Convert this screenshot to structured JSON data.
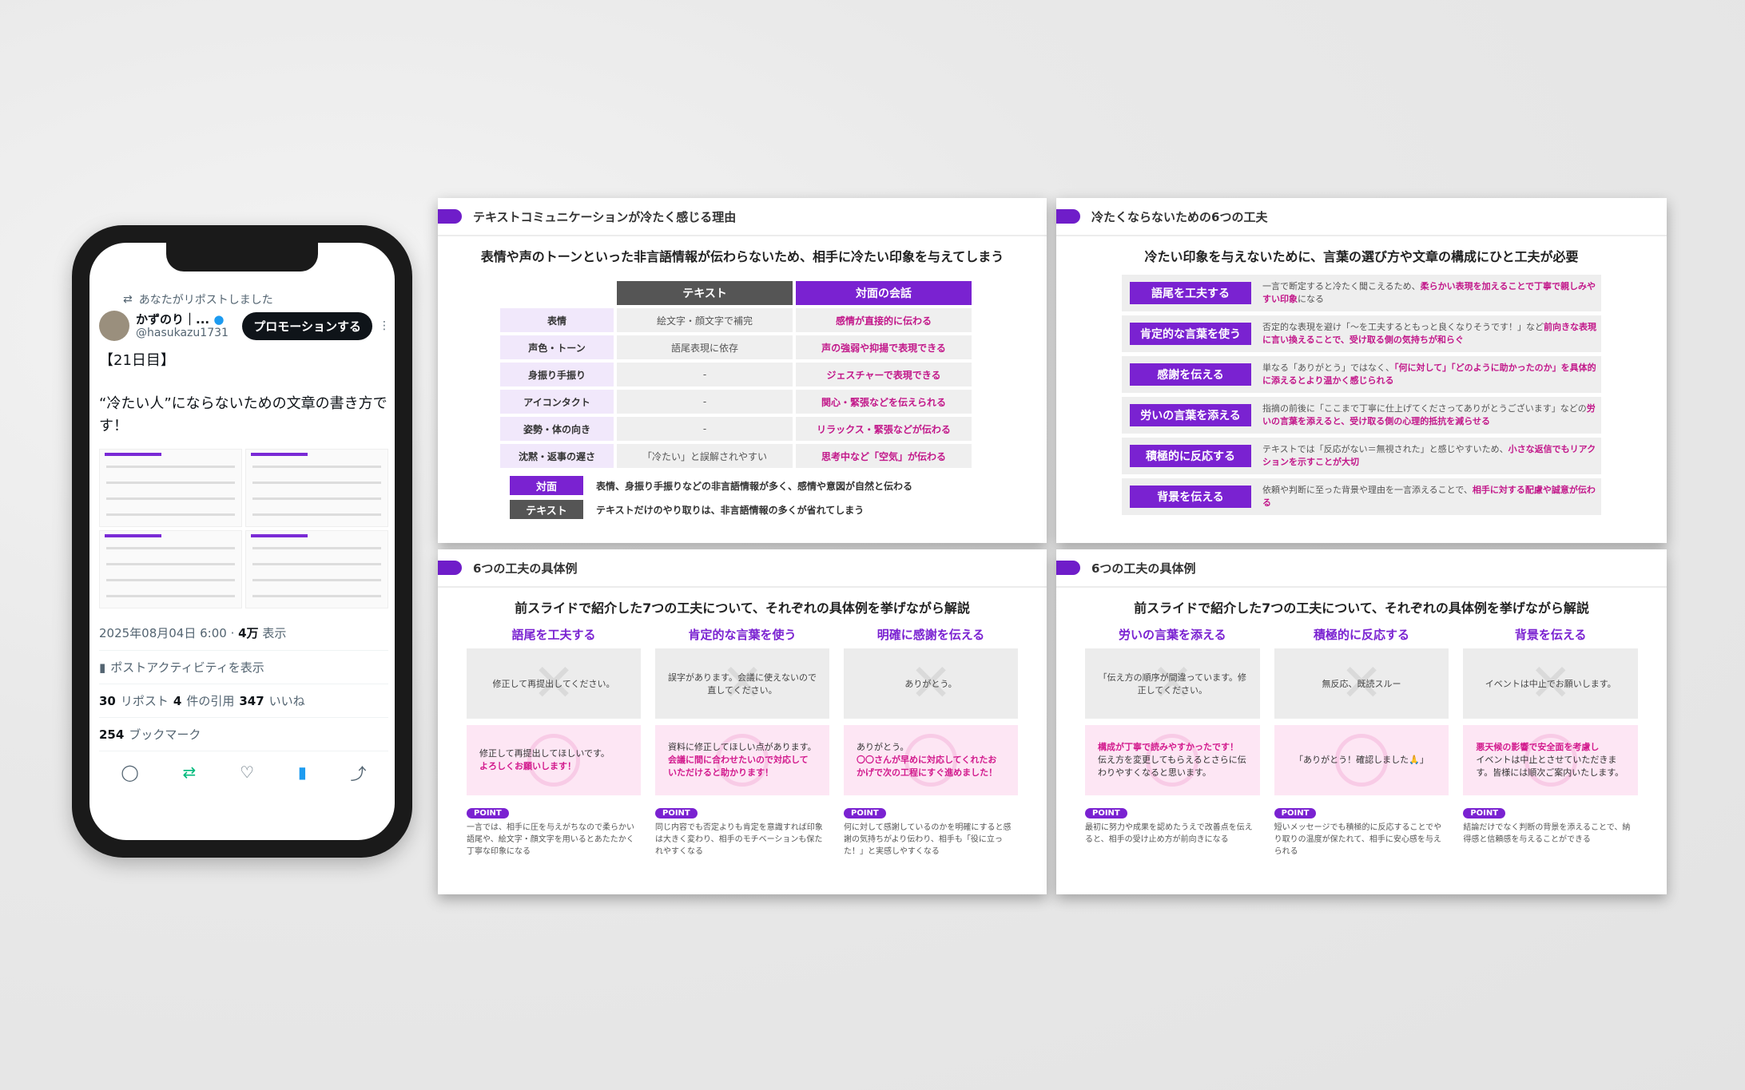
{
  "tweet": {
    "repost_notice": "あなたがリポストしました",
    "user_name": "かずのり｜...",
    "handle": "@hasukazu1731",
    "promo_button": "プロモーションする",
    "text_line1": "【21日目】",
    "text_line2": "“冷たい人”にならないための文章の書き方です！",
    "timestamp": "2025年08月04日 6:00 · ",
    "views": "4万",
    "views_label": " 表示",
    "activity_label": "ポストアクティビティを表示",
    "reposts": "30",
    "reposts_label": " リポスト ",
    "quotes": "4",
    "quotes_label": " 件の引用 ",
    "likes": "347",
    "likes_label": " いいね",
    "bookmarks": "254",
    "bookmarks_label": " ブックマーク"
  },
  "slide1": {
    "title": "テキストコミュニケーションが冷たく感じる理由",
    "subtitle": "表情や声のトーンといった非言語情報が伝わらないため、相手に冷たい印象を与えてしまう",
    "col_text": "テキスト",
    "col_face": "対面の会話",
    "rows": [
      {
        "label": "表情",
        "text": "絵文字・顔文字で補完",
        "face": "感情が直接的に伝わる"
      },
      {
        "label": "声色・トーン",
        "text": "語尾表現に依存",
        "face": "声の強弱や抑揚で表現できる"
      },
      {
        "label": "身振り手振り",
        "text": "-",
        "face": "ジェスチャーで表現できる"
      },
      {
        "label": "アイコンタクト",
        "text": "-",
        "face": "関心・緊張などを伝えられる"
      },
      {
        "label": "姿勢・体の向き",
        "text": "-",
        "face": "リラックス・緊張などが伝わる"
      },
      {
        "label": "沈黙・返事の遅さ",
        "text": "「冷たい」と誤解されやすい",
        "face": "思考中など「空気」が伝わる"
      }
    ],
    "legend_face_label": "対面",
    "legend_face_text": "表情、身振り手振りなどの非言語情報が多く、感情や意図が自然と伝わる",
    "legend_text_label": "テキスト",
    "legend_text_text": "テキストだけのやり取りは、非言語情報の多くが省れてしまう"
  },
  "slide2": {
    "title": "冷たくならないための6つの工夫",
    "subtitle": "冷たい印象を与えないために、言葉の選び方や文章の構成にひと工夫が必要",
    "tips": [
      {
        "label": "語尾を工夫する",
        "text": "一言で断定すると冷たく聞こえるため、",
        "em": "柔らかい表現を加えることで丁寧で親しみやすい印象",
        "tail": "になる"
      },
      {
        "label": "肯定的な言葉を使う",
        "text": "否定的な表現を避け「〜を工夫するともっと良くなりそうです！」など",
        "em": "前向きな表現に言い換えることで、受け取る側の気持ちが和らぐ",
        "tail": ""
      },
      {
        "label": "感謝を伝える",
        "text": "単なる「ありがとう」ではなく、",
        "em": "「何に対して」「どのように助かったのか」を具体的に添えるとより温かく感じられる",
        "tail": ""
      },
      {
        "label": "労いの言葉を添える",
        "text": "指摘の前後に「ここまで丁寧に仕上げてくださってありがとうございます」などの",
        "em": "労いの言葉を添えると、受け取る側の心理的抵抗を減らせる",
        "tail": ""
      },
      {
        "label": "積極的に反応する",
        "text": "テキストでは「反応がない＝無視された」と感じやすいため、",
        "em": "小さな返信でもリアクションを示すことが大切",
        "tail": ""
      },
      {
        "label": "背景を伝える",
        "text": "依頼や判断に至った背景や理由を一言添えることで、",
        "em": "相手に対する配慮や誠意が伝わる",
        "tail": ""
      }
    ]
  },
  "slide3": {
    "title": "6つの工夫の具体例",
    "subtitle": "前スライドで紹介した7つの工夫について、それぞれの具体例を挙げながら解説",
    "cols": [
      {
        "head": "語尾を工夫する",
        "bad": "修正して再提出してください。",
        "good1": "修正して再提出してほしいです。",
        "good2": "よろしくお願いします！",
        "point_label": "POINT",
        "point": "一言では、相手に圧を与えがちなので柔らかい語尾や、絵文字・顔文字を用いるとあたたかく丁寧な印象になる"
      },
      {
        "head": "肯定的な言葉を使う",
        "bad": "誤字があります。会議に使えないので直してください。",
        "good1": "資料に修正してほしい点があります。",
        "good2": "会議に間に合わせたいので対応していただけると助かります！",
        "point_label": "POINT",
        "point": "同じ内容でも否定よりも肯定を意識すれば印象は大きく変わり、相手のモチベーションも保たれやすくなる"
      },
      {
        "head": "明確に感謝を伝える",
        "bad": "ありがとう。",
        "good1": "ありがとう。",
        "good2": "〇〇さんが早めに対応してくれたおかげで次の工程にすぐ進めました！",
        "point_label": "POINT",
        "point": "何に対して感謝しているのかを明確にすると感謝の気持ちがより伝わり、相手も「役に立った！」と実感しやすくなる"
      }
    ]
  },
  "slide4": {
    "title": "6つの工夫の具体例",
    "subtitle": "前スライドで紹介した7つの工夫について、それぞれの具体例を挙げながら解説",
    "cols": [
      {
        "head": "労いの言葉を添える",
        "bad": "「伝え方の順序が間違っています。修正してください。",
        "good1": "構成が丁寧で読みやすかったです！",
        "good2": "伝え方を変更してもらえるとさらに伝わりやすくなると思います。",
        "point_label": "POINT",
        "point": "最初に努力や成果を認めたうえで改善点を伝えると、相手の受け止め方が前向きになる"
      },
      {
        "head": "積極的に反応する",
        "bad": "無反応、既読スルー",
        "good1": "「ありがとう！確認しました🙏」",
        "good2": "",
        "point_label": "POINT",
        "point": "短いメッセージでも積極的に反応することでやり取りの温度が保たれて、相手に安心感を与えられる"
      },
      {
        "head": "背景を伝える",
        "bad": "イベントは中止でお願いします。",
        "good1": "悪天候の影響で安全面を考慮し",
        "good2": "イベントは中止とさせていただきます。皆様には順次ご案内いたします。",
        "point_label": "POINT",
        "point": "結論だけでなく判断の背景を添えることで、納得感と信頼感を与えることができる"
      }
    ]
  },
  "colors": {
    "purple": "#7a22d1",
    "pink": "#d21a8d"
  }
}
